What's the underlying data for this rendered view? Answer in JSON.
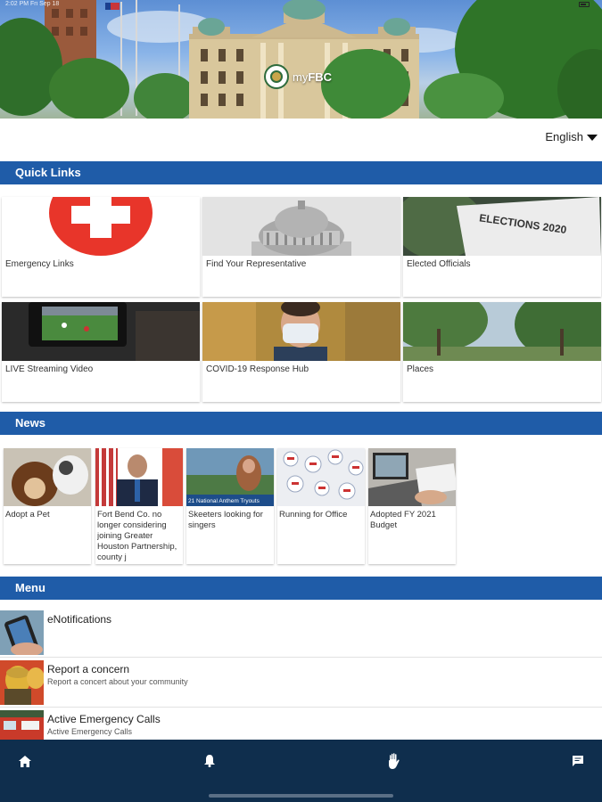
{
  "status_bar": {
    "time": "2:02 PM  Fri Sep 18"
  },
  "header": {
    "logo_prefix": "my",
    "logo_suffix": "FBC"
  },
  "language": {
    "selected": "English",
    "icon": "caret-down-icon"
  },
  "quick_links": {
    "title": "Quick Links",
    "items": [
      {
        "label": "Emergency Links",
        "image": "red-cross"
      },
      {
        "label": "Find Your Representative",
        "image": "capitol-dome"
      },
      {
        "label": "Elected Officials",
        "image": "elections-2020-sign",
        "image_text": "ELECTIONS 2020"
      },
      {
        "label": "LIVE Streaming Video",
        "image": "camera-monitor"
      },
      {
        "label": "COVID-19 Response Hub",
        "image": "man-with-mask"
      },
      {
        "label": "Places",
        "image": "park-trees"
      }
    ]
  },
  "news": {
    "title": "News",
    "items": [
      {
        "label": "Adopt a Pet",
        "image": "dog-and-cat"
      },
      {
        "label": "Fort Bend Co. no longer considering joining Greater Houston Partnership, county j",
        "image": "official-at-podium"
      },
      {
        "label": "Skeeters looking for singers",
        "image": "singer-at-ballpark",
        "image_text": "21 National Anthem Tryouts"
      },
      {
        "label": "Running for Office",
        "image": "vote-buttons"
      },
      {
        "label": "Adopted FY 2021 Budget",
        "image": "laptop-budget"
      }
    ]
  },
  "menu": {
    "title": "Menu",
    "items": [
      {
        "title": "eNotifications",
        "subtitle": "",
        "image": "phone-in-hand"
      },
      {
        "title": "Report a concern",
        "subtitle": "Report a concert about your community",
        "image": "firefighters"
      },
      {
        "title": "Active Emergency Calls",
        "subtitle": "Active Emergency Calls",
        "image": "emergency-vehicle"
      }
    ]
  },
  "tabbar": {
    "items": [
      {
        "icon": "home-icon"
      },
      {
        "icon": "bell-icon"
      },
      {
        "icon": "hand-icon"
      },
      {
        "icon": "chat-icon"
      }
    ]
  },
  "colors": {
    "section_bar": "#1f5ca8",
    "tabbar": "#0f2e4d",
    "emergency_red": "#e8352a"
  }
}
